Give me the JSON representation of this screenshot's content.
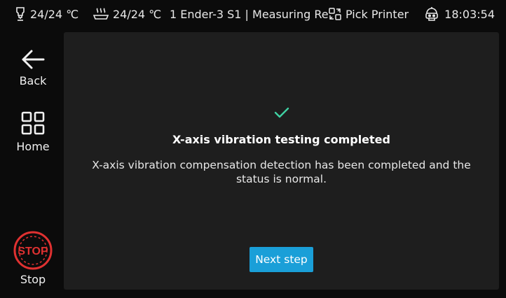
{
  "status_bar": {
    "nozzle_temp": "24/24 ℃",
    "bed_temp": "24/24 ℃",
    "job": "1 Ender-3 S1 | Measuring Re",
    "printer_picker": "Pick Printer",
    "time": "18:03:54"
  },
  "sidebar": {
    "back_label": "Back",
    "home_label": "Home",
    "stop_label": "Stop",
    "stop_icon_text": "STOP"
  },
  "dialog": {
    "title": "X-axis vibration testing completed",
    "message": "X-axis vibration compensation detection has been completed and the status is normal.",
    "next_label": "Next step"
  },
  "colors": {
    "accent": "#1a9fd8",
    "check": "#3fd1a3",
    "stop": "#e03131",
    "panel": "#1e1e1e",
    "background": "#0b0b0b"
  }
}
